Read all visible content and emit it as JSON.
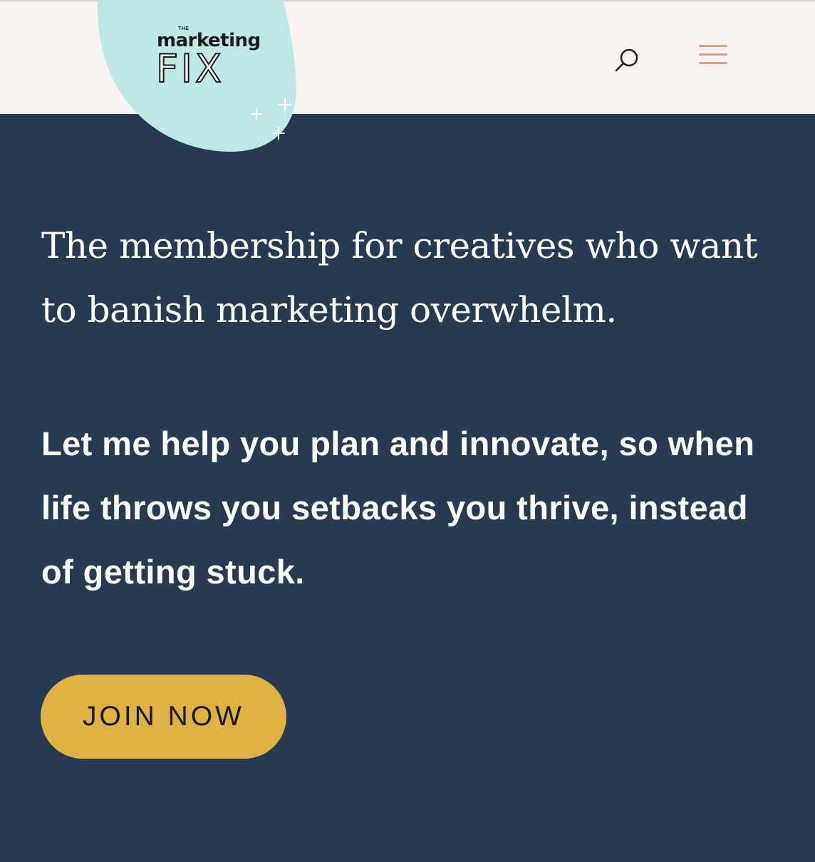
{
  "header": {
    "logo": {
      "the_text": "THE",
      "marketing_text": "marketing",
      "fix_text": "FIX"
    },
    "search_icon": "search-icon",
    "menu_icon": "hamburger-menu-icon"
  },
  "hero": {
    "heading": "The membership for creatives who want to banish marketing overwhelm.",
    "subheading": "Let me help you plan and innovate, so when life throws you setbacks you thrive, instead of getting stuck.",
    "cta_label": "JOIN NOW"
  },
  "colors": {
    "header_background": "#f8f3f0",
    "page_background": "#273a51",
    "logo_blob": "#bde8e6",
    "menu_accent": "#f0997a",
    "cta_background": "#dfb343",
    "text_light": "#ffffff"
  }
}
